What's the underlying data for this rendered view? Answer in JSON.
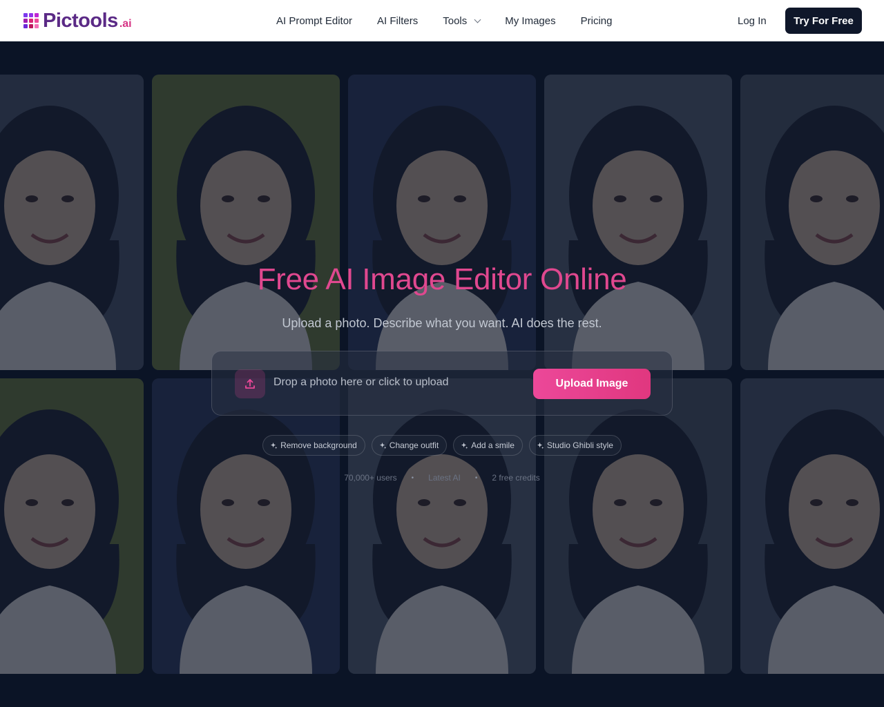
{
  "nav": {
    "logo_text": "Pictools",
    "logo_suffix": ".ai",
    "logo_colors": [
      "#7c3aed",
      "#9333ea",
      "#c026d3",
      "#a21caf",
      "#db2777",
      "#ec4899",
      "#6d28d9",
      "#be185d",
      "#f472b6"
    ],
    "items": [
      {
        "label": "AI Prompt Editor"
      },
      {
        "label": "AI Filters"
      },
      {
        "label": "Tools"
      },
      {
        "label": "My Images"
      },
      {
        "label": "Pricing"
      }
    ],
    "login_label": "Log In",
    "cta_label": "Try For Free"
  },
  "hero": {
    "title": "Free AI Image Editor Online",
    "subtitle": "Upload a photo. Describe what you want. AI does the rest.",
    "upload_prompt": "Drop a photo here or click to upload",
    "upload_button": "Upload Image",
    "chips": [
      {
        "label": "Remove background"
      },
      {
        "label": "Change outfit"
      },
      {
        "label": "Add a smile"
      },
      {
        "label": "Studio Ghibli style"
      }
    ],
    "stats": [
      {
        "label": "70,000+ users"
      },
      {
        "label": "Latest AI"
      },
      {
        "label": "2 free credits"
      }
    ],
    "stat_separator": "•"
  },
  "colors": {
    "accent": "#e0488f",
    "nav_cta_bg": "#0f172a",
    "hero_bg": "#0c1527"
  }
}
